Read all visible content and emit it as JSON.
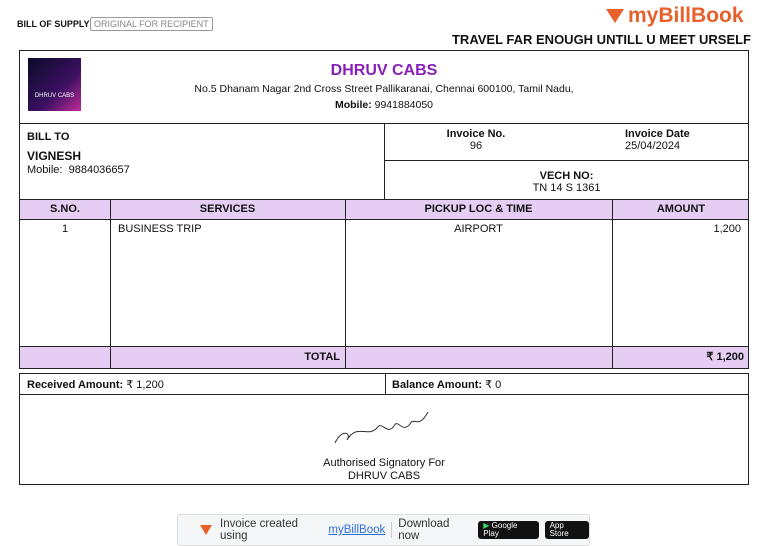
{
  "top": {
    "doc_type": "BILL OF SUPPLY",
    "copy_label": "ORIGINAL FOR RECIPIENT",
    "brand": "myBillBook",
    "tagline": "TRAVEL FAR ENOUGH UNTILL U MEET URSELF"
  },
  "company": {
    "logo_text": "DHRUV CABS",
    "name": "DHRUV CABS",
    "address": "No.5 Dhanam Nagar 2nd Cross Street Pallikaranai, Chennai 600100, Tamil Nadu,",
    "mobile_label": "Mobile:",
    "mobile": "9941884050"
  },
  "bill_to": {
    "label": "BILL TO",
    "name": "VIGNESH",
    "mobile_label": "Mobile:",
    "mobile": "9884036657"
  },
  "invoice": {
    "no_label": "Invoice No.",
    "no": "96",
    "date_label": "Invoice Date",
    "date": "25/04/2024",
    "vech_label": "VECH NO:",
    "vech": "TN 14 S 1361"
  },
  "table": {
    "headers": [
      "S.NO.",
      "SERVICES",
      "PICKUP LOC & TIME",
      "AMOUNT"
    ],
    "rows": [
      {
        "sno": "1",
        "service": "BUSINESS TRIP",
        "pickup": "AIRPORT",
        "amount": "1,200"
      }
    ],
    "total_label": "TOTAL",
    "total": "₹ 1,200"
  },
  "payment": {
    "received_label": "Received Amount:",
    "received": "₹ 1,200",
    "balance_label": "Balance Amount:",
    "balance": "₹ 0"
  },
  "signature": {
    "label": "Authorised Signatory For",
    "company": "DHRUV CABS"
  },
  "footer": {
    "created": "Invoice created using",
    "link": "myBillBook",
    "download": "Download now",
    "google": "Google Play",
    "google_small": "GET IT ON",
    "apple": "App Store",
    "apple_small": "Download on the"
  }
}
